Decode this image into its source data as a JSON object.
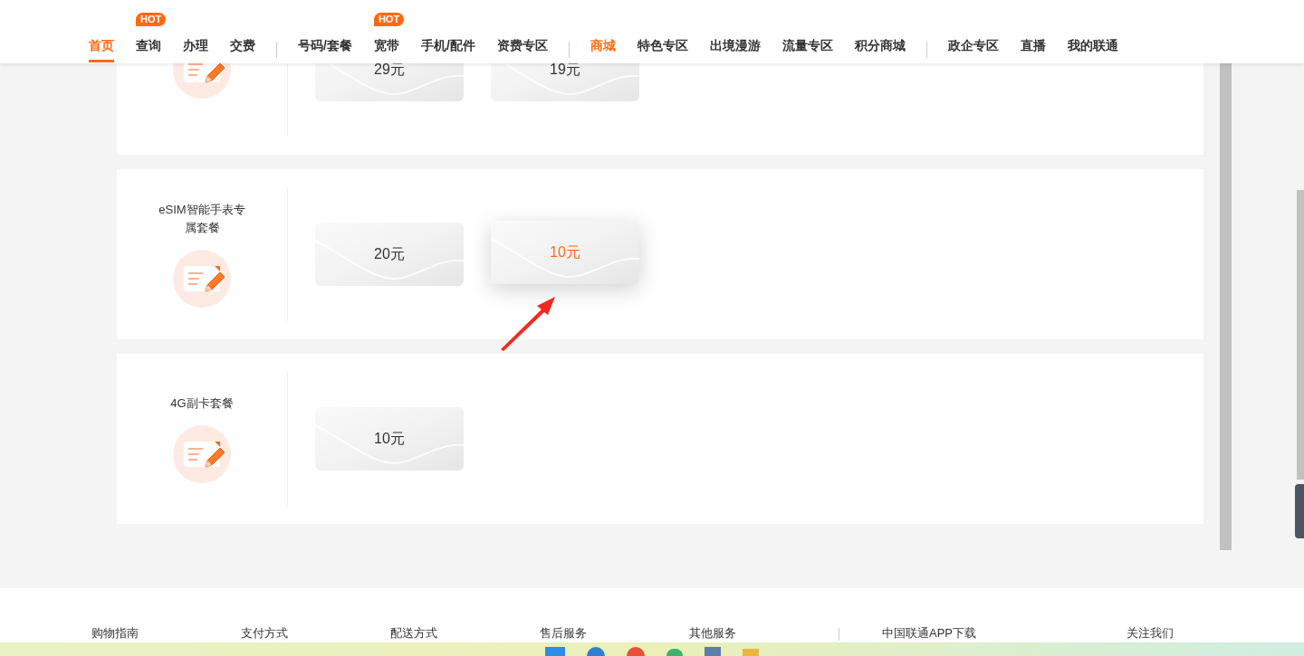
{
  "nav": {
    "groups": [
      [
        {
          "label": "首页",
          "selected": true,
          "highlight": false
        },
        {
          "label": "查询",
          "selected": false,
          "highlight": false,
          "badge": "HOT"
        },
        {
          "label": "办理",
          "selected": false,
          "highlight": false
        },
        {
          "label": "交费",
          "selected": false,
          "highlight": false
        }
      ],
      [
        {
          "label": "号码/套餐",
          "selected": false,
          "highlight": false
        },
        {
          "label": "宽带",
          "selected": false,
          "highlight": false,
          "badge": "HOT"
        },
        {
          "label": "手机/配件",
          "selected": false,
          "highlight": false
        },
        {
          "label": "资费专区",
          "selected": false,
          "highlight": false
        }
      ],
      [
        {
          "label": "商城",
          "selected": false,
          "highlight": true
        },
        {
          "label": "特色专区",
          "selected": false,
          "highlight": false
        },
        {
          "label": "出境漫游",
          "selected": false,
          "highlight": false
        },
        {
          "label": "流量专区",
          "selected": false,
          "highlight": false
        },
        {
          "label": "积分商城",
          "selected": false,
          "highlight": false
        }
      ],
      [
        {
          "label": "政企专区",
          "selected": false,
          "highlight": false
        },
        {
          "label": "直播",
          "selected": false,
          "highlight": false
        },
        {
          "label": "我的联通",
          "selected": false,
          "highlight": false
        }
      ]
    ]
  },
  "plans": [
    {
      "prices": [
        {
          "label": "29元",
          "selected": false
        },
        {
          "label": "19元",
          "selected": false
        }
      ]
    },
    {
      "name": "eSIM智能手表专属套餐",
      "prices": [
        {
          "label": "20元",
          "selected": false
        },
        {
          "label": "10元",
          "selected": true
        }
      ]
    },
    {
      "name": "4G副卡套餐",
      "prices": [
        {
          "label": "10元",
          "selected": false
        }
      ]
    }
  ],
  "footer": {
    "links": [
      "购物指南",
      "支付方式",
      "配送方式",
      "售后服务",
      "其他服务"
    ],
    "app": "中国联通APP下载",
    "follow": "关注我们"
  }
}
